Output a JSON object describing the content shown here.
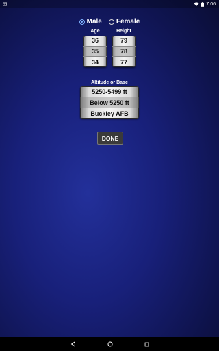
{
  "statusbar": {
    "time": "7:06",
    "left_icons": [
      "mail-icon"
    ],
    "right_icons": [
      "wifi-icon",
      "battery-icon"
    ]
  },
  "sex": {
    "options": [
      "Male",
      "Female"
    ],
    "selected": "Male"
  },
  "age": {
    "label": "Age",
    "values": [
      "36",
      "35",
      "34"
    ],
    "selected": "35"
  },
  "height": {
    "label": "Height",
    "values": [
      "79",
      "78",
      "77"
    ],
    "selected": "78"
  },
  "altitude": {
    "label": "Altitude or Base",
    "values": [
      "5250-5499 ft",
      "Below 5250 ft",
      "Buckley AFB"
    ],
    "selected": "Below 5250 ft"
  },
  "done_label": "DONE",
  "navbar": {
    "buttons": [
      "back-icon",
      "home-icon",
      "recents-icon"
    ]
  },
  "colors": {
    "radio_accent": "#7fb2ff",
    "background": "#18207a"
  }
}
